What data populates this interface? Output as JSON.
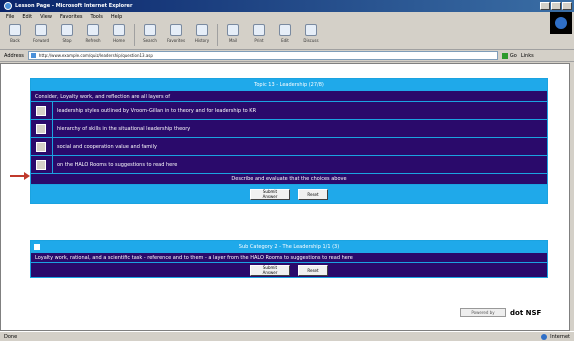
{
  "window": {
    "title": "Lesson Page - Microsoft Internet Explorer"
  },
  "menu": [
    "File",
    "Edit",
    "View",
    "Favorites",
    "Tools",
    "Help"
  ],
  "toolbar": [
    {
      "label": "Back",
      "icon": "back-icon"
    },
    {
      "label": "Forward",
      "icon": "forward-icon"
    },
    {
      "label": "Stop",
      "icon": "stop-icon"
    },
    {
      "label": "Refresh",
      "icon": "refresh-icon"
    },
    {
      "label": "Home",
      "icon": "home-icon"
    },
    {
      "label": "Search",
      "icon": "search-icon"
    },
    {
      "label": "Favorites",
      "icon": "favorites-icon"
    },
    {
      "label": "History",
      "icon": "history-icon"
    },
    {
      "label": "Mail",
      "icon": "mail-icon"
    },
    {
      "label": "Print",
      "icon": "print-icon"
    },
    {
      "label": "Edit",
      "icon": "edit-icon"
    },
    {
      "label": "Discuss",
      "icon": "discuss-icon"
    }
  ],
  "address": {
    "label": "Address",
    "url": "http://www.example.com/quiz/leadership/question13.asp",
    "go": "Go",
    "links": "Links"
  },
  "quiz": {
    "header": "Topic 13 - Leadership (27/8)",
    "question": "Consider, Loyalty work, and reflection are all layers of",
    "options": [
      "leadership styles outlined by Vroom-Gillan in to theory and for leadership to KR",
      "hierarchy of skills in the situational leadership theory",
      "social and cooperation value and family",
      "on the HALO Rooms to suggestions to read here"
    ],
    "describe": "Describe and evaluate that the choices above",
    "buttons": {
      "submit": "Submit Answer",
      "reset": "Reset"
    }
  },
  "answer": {
    "header": "Sub Category 2 - The Leadership 1/1 (3)",
    "text": "Loyalty work, rational, and a scientific task - reference and to them - a layer from the HALO Rooms to suggestions to read here",
    "buttons": {
      "submit": "Submit Answer",
      "reset": "Reset"
    }
  },
  "brand": {
    "box_text": "Powered by",
    "name": "dot NSF"
  },
  "status": {
    "left": "Done",
    "zone": "Internet"
  },
  "colors": {
    "panel_bg": "#2a0a6b",
    "panel_accent": "#1fa9ea",
    "arrow": "#c0392b"
  }
}
